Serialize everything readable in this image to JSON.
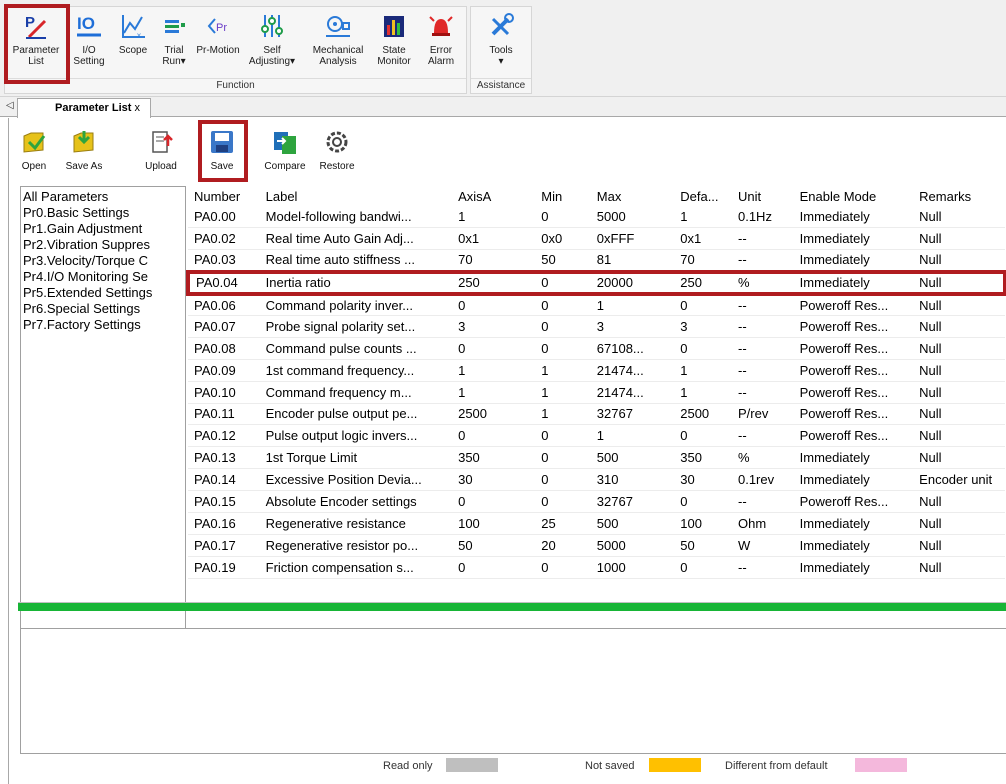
{
  "ribbon": {
    "function_group": {
      "caption": "Function",
      "buttons": [
        {
          "line1": "Parameter",
          "line2": "List",
          "icon": "parameter-list-icon"
        },
        {
          "line1": "I/O",
          "line2": "Setting",
          "icon": "io-setting-icon"
        },
        {
          "line1": "Scope",
          "line2": "",
          "icon": "scope-icon"
        },
        {
          "line1": "Trial",
          "line2": "Run▾",
          "icon": "trial-run-icon"
        },
        {
          "line1": "Pr-Motion",
          "line2": "",
          "icon": "pr-motion-icon"
        },
        {
          "line1": "Self",
          "line2": "Adjusting▾",
          "icon": "self-adjusting-icon"
        },
        {
          "line1": "Mechanical",
          "line2": "Analysis",
          "icon": "mechanical-analysis-icon"
        },
        {
          "line1": "State",
          "line2": "Monitor",
          "icon": "state-monitor-icon"
        },
        {
          "line1": "Error",
          "line2": "Alarm",
          "icon": "error-alarm-icon"
        }
      ]
    },
    "assistance_group": {
      "caption": "Assistance",
      "buttons": [
        {
          "line1": "Tools",
          "line2": "▾",
          "icon": "tools-icon"
        }
      ]
    }
  },
  "tabs": {
    "scroll_glyph": "◁",
    "active": {
      "label": "Parameter List",
      "close": "x"
    }
  },
  "toolbar": {
    "buttons": [
      {
        "label": "Open",
        "icon": "open-folder-icon"
      },
      {
        "label": "Save As",
        "icon": "save-as-icon"
      },
      {
        "label": "Upload",
        "icon": "upload-icon"
      },
      {
        "label": "Save",
        "icon": "save-icon"
      },
      {
        "label": "Compare",
        "icon": "compare-icon"
      },
      {
        "label": "Restore",
        "icon": "restore-icon"
      }
    ]
  },
  "tree": {
    "items": [
      "All Parameters",
      "Pr0.Basic Settings",
      "Pr1.Gain Adjustment",
      "Pr2.Vibration Suppres",
      "Pr3.Velocity/Torque C",
      "Pr4.I/O Monitoring Se",
      "Pr5.Extended Settings",
      "Pr6.Special Settings",
      "Pr7.Factory Settings"
    ]
  },
  "grid": {
    "columns": [
      "Number",
      "Label",
      "AxisA",
      "Min",
      "Max",
      "Defa...",
      "Unit",
      "Enable Mode",
      "Remarks"
    ],
    "highlighted_row": "PA0.04",
    "rows": [
      [
        "PA0.00",
        "Model-following bandwi...",
        "1",
        "0",
        "5000",
        "1",
        "0.1Hz",
        "Immediately",
        "Null"
      ],
      [
        "PA0.02",
        "Real time Auto Gain Adj...",
        "0x1",
        "0x0",
        "0xFFF",
        "0x1",
        "--",
        "Immediately",
        "Null"
      ],
      [
        "PA0.03",
        "Real time auto stiffness ...",
        "70",
        "50",
        "81",
        "70",
        "--",
        "Immediately",
        "Null"
      ],
      [
        "PA0.04",
        "Inertia ratio",
        "250",
        "0",
        "20000",
        "250",
        "%",
        "Immediately",
        "Null"
      ],
      [
        "PA0.06",
        "Command polarity inver...",
        "0",
        "0",
        "1",
        "0",
        "--",
        "Poweroff Res...",
        "Null"
      ],
      [
        "PA0.07",
        "Probe signal polarity set...",
        "3",
        "0",
        "3",
        "3",
        "--",
        "Poweroff Res...",
        "Null"
      ],
      [
        "PA0.08",
        "Command pulse counts ...",
        "0",
        "0",
        "67108...",
        "0",
        "--",
        "Poweroff Res...",
        "Null"
      ],
      [
        "PA0.09",
        "1st command frequency...",
        "1",
        "1",
        "21474...",
        "1",
        "--",
        "Poweroff Res...",
        "Null"
      ],
      [
        "PA0.10",
        "Command frequency m...",
        "1",
        "1",
        "21474...",
        "1",
        "--",
        "Poweroff Res...",
        "Null"
      ],
      [
        "PA0.11",
        "Encoder pulse output pe...",
        "2500",
        "1",
        "32767",
        "2500",
        "P/rev",
        "Poweroff Res...",
        "Null"
      ],
      [
        "PA0.12",
        "Pulse output logic invers...",
        "0",
        "0",
        "1",
        "0",
        "--",
        "Poweroff Res...",
        "Null"
      ],
      [
        "PA0.13",
        "1st Torque Limit",
        "350",
        "0",
        "500",
        "350",
        "%",
        "Immediately",
        "Null"
      ],
      [
        "PA0.14",
        "Excessive Position Devia...",
        "30",
        "0",
        "310",
        "30",
        "0.1rev",
        "Immediately",
        "Encoder unit"
      ],
      [
        "PA0.15",
        "Absolute Encoder settings",
        "0",
        "0",
        "32767",
        "0",
        "--",
        "Poweroff Res...",
        "Null"
      ],
      [
        "PA0.16",
        "Regenerative resistance",
        "100",
        "25",
        "500",
        "100",
        "Ohm",
        "Immediately",
        "Null"
      ],
      [
        "PA0.17",
        "Regenerative resistor po...",
        "50",
        "20",
        "5000",
        "50",
        "W",
        "Immediately",
        "Null"
      ],
      [
        "PA0.19",
        "Friction compensation s...",
        "0",
        "0",
        "1000",
        "0",
        "--",
        "Immediately",
        "Null"
      ]
    ]
  },
  "progress": {
    "fraction": 1.0,
    "color": "#17b536"
  },
  "legend": [
    {
      "label": "Read only",
      "color": "#bfbfbf"
    },
    {
      "label": "Not saved",
      "color": "#ffc000"
    },
    {
      "label": "Different from default",
      "color": "#f4b8dc"
    }
  ],
  "colors": {
    "highlight": "#b01c20"
  }
}
